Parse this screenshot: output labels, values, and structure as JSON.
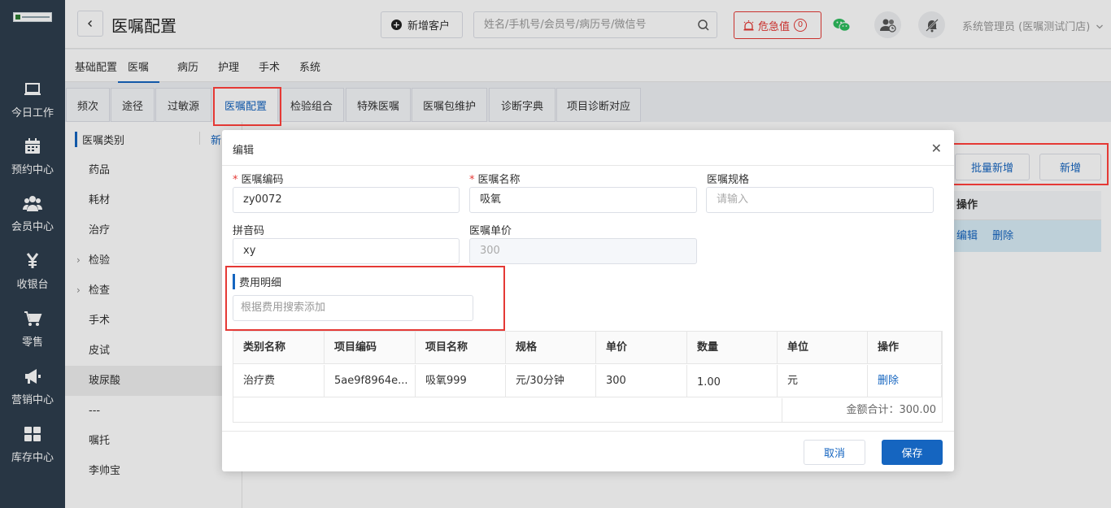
{
  "nav": {
    "items": [
      {
        "label": "今日工作",
        "icon": "laptop-icon"
      },
      {
        "label": "预约中心",
        "icon": "calendar-icon"
      },
      {
        "label": "会员中心",
        "icon": "users-icon"
      },
      {
        "label": "收银台",
        "icon": "yen-icon"
      },
      {
        "label": "零售",
        "icon": "cart-icon"
      },
      {
        "label": "营销中心",
        "icon": "megaphone-icon"
      },
      {
        "label": "库存中心",
        "icon": "grid-icon"
      }
    ]
  },
  "header": {
    "title": "医嘱配置",
    "add_customer": "新增客户",
    "search_placeholder": "姓名/手机号/会员号/病历号/微信号",
    "critical_label": "危急值",
    "critical_count": "0",
    "user": "系统管理员 (医嘱测试门店)"
  },
  "subnav": [
    "基础配置",
    "医嘱",
    "病历",
    "护理",
    "手术",
    "系统"
  ],
  "tabs": [
    "频次",
    "途径",
    "过敏源",
    "医嘱配置",
    "检验组合",
    "特殊医嘱",
    "医嘱包维护",
    "诊断字典",
    "项目诊断对应"
  ],
  "category": {
    "title": "医嘱类别",
    "new_label": "新",
    "items": [
      "药品",
      "耗材",
      "治疗",
      "检验",
      "检查",
      "手术",
      "皮试",
      "玻尿酸",
      "---",
      "嘱托",
      "李帅宝"
    ]
  },
  "right": {
    "batch_add": "批量新增",
    "add": "新增",
    "col_action": "操作",
    "edit": "编辑",
    "delete": "删除"
  },
  "modal": {
    "title": "编辑",
    "code_label": "医嘱编码",
    "code_value": "zy0072",
    "name_label": "医嘱名称",
    "name_value": "吸氧",
    "spec_label": "医嘱规格",
    "spec_placeholder": "请输入",
    "pinyin_label": "拼音码",
    "pinyin_value": "xy",
    "price_label": "医嘱单价",
    "price_value": "300",
    "fee_section": "费用明细",
    "fee_search_placeholder": "根据费用搜索添加",
    "table": {
      "headers": [
        "类别名称",
        "项目编码",
        "项目名称",
        "规格",
        "单价",
        "数量",
        "单位",
        "操作"
      ],
      "rows": [
        [
          "治疗费",
          "5ae9f8964e...",
          "吸氧999",
          "元/30分钟",
          "300",
          "1.00",
          "元",
          "删除"
        ]
      ],
      "total": "金额合计：300.00"
    },
    "cancel": "取消",
    "save": "保存"
  },
  "colors": {
    "accent": "#1565c0",
    "nav_bg": "#2e3e4e",
    "danger": "#e53935",
    "wechat": "#2ebd5e"
  }
}
